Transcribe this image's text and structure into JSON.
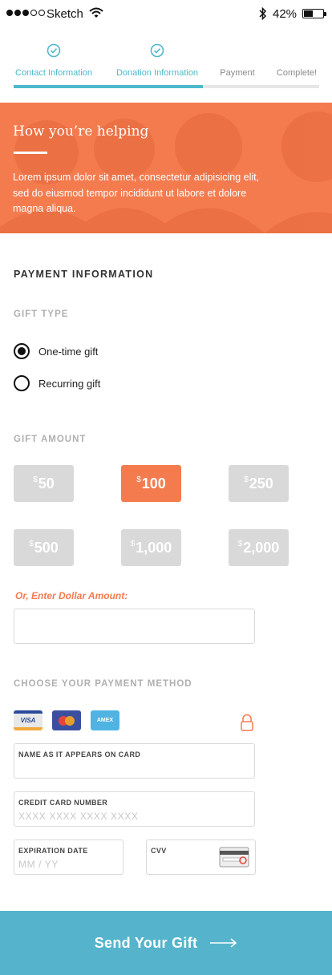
{
  "status_bar": {
    "carrier": "Sketch",
    "battery": "42%",
    "battery_level": 0.42,
    "signal_bars": 3,
    "signal_total": 5
  },
  "steps": [
    {
      "label": "Contact Information",
      "state": "done"
    },
    {
      "label": "Donation Information",
      "state": "done"
    },
    {
      "label": "Payment",
      "state": "todo"
    },
    {
      "label": "Complete!",
      "state": "todo"
    }
  ],
  "steps_progress": 0.62,
  "hero": {
    "title": "How you’re helping",
    "text": "Lorem ipsum dolor sit amet, consectetur adipisicing elit, sed do eiusmod tempor incididunt ut labore et dolore magna aliqua."
  },
  "payment": {
    "title": "PAYMENT INFORMATION",
    "gift_type": {
      "title": "GIFT TYPE",
      "options": [
        {
          "label": "One-time gift",
          "checked": true
        },
        {
          "label": "Recurring gift",
          "checked": false
        }
      ]
    },
    "gift_amount": {
      "title": "GIFT AMOUNT",
      "currency": "$",
      "amounts": [
        "50",
        "100",
        "250",
        "500",
        "1,000",
        "2,000"
      ],
      "selected": "100",
      "enter_label": "Or, Enter Dollar Amount:"
    },
    "method": {
      "title": "CHOOSE YOUR PAYMENT METHOD",
      "cards": [
        "VISA",
        "mastercard",
        "AMEX"
      ],
      "name_label": "NAME AS IT APPEARS ON CARD",
      "card_number_label": "CREDIT CARD NUMBER",
      "card_number_placeholder": "XXXX XXXX XXXX XXXX",
      "expiry_label": "EXPIRATION DATE",
      "expiry_placeholder": "MM / YY",
      "cvv_label": "CVV"
    }
  },
  "submit": {
    "label": "Send Your Gift"
  },
  "colors": {
    "accent": "#f47b4e",
    "teal": "#4cb8cc",
    "button": "#55b4cc"
  }
}
